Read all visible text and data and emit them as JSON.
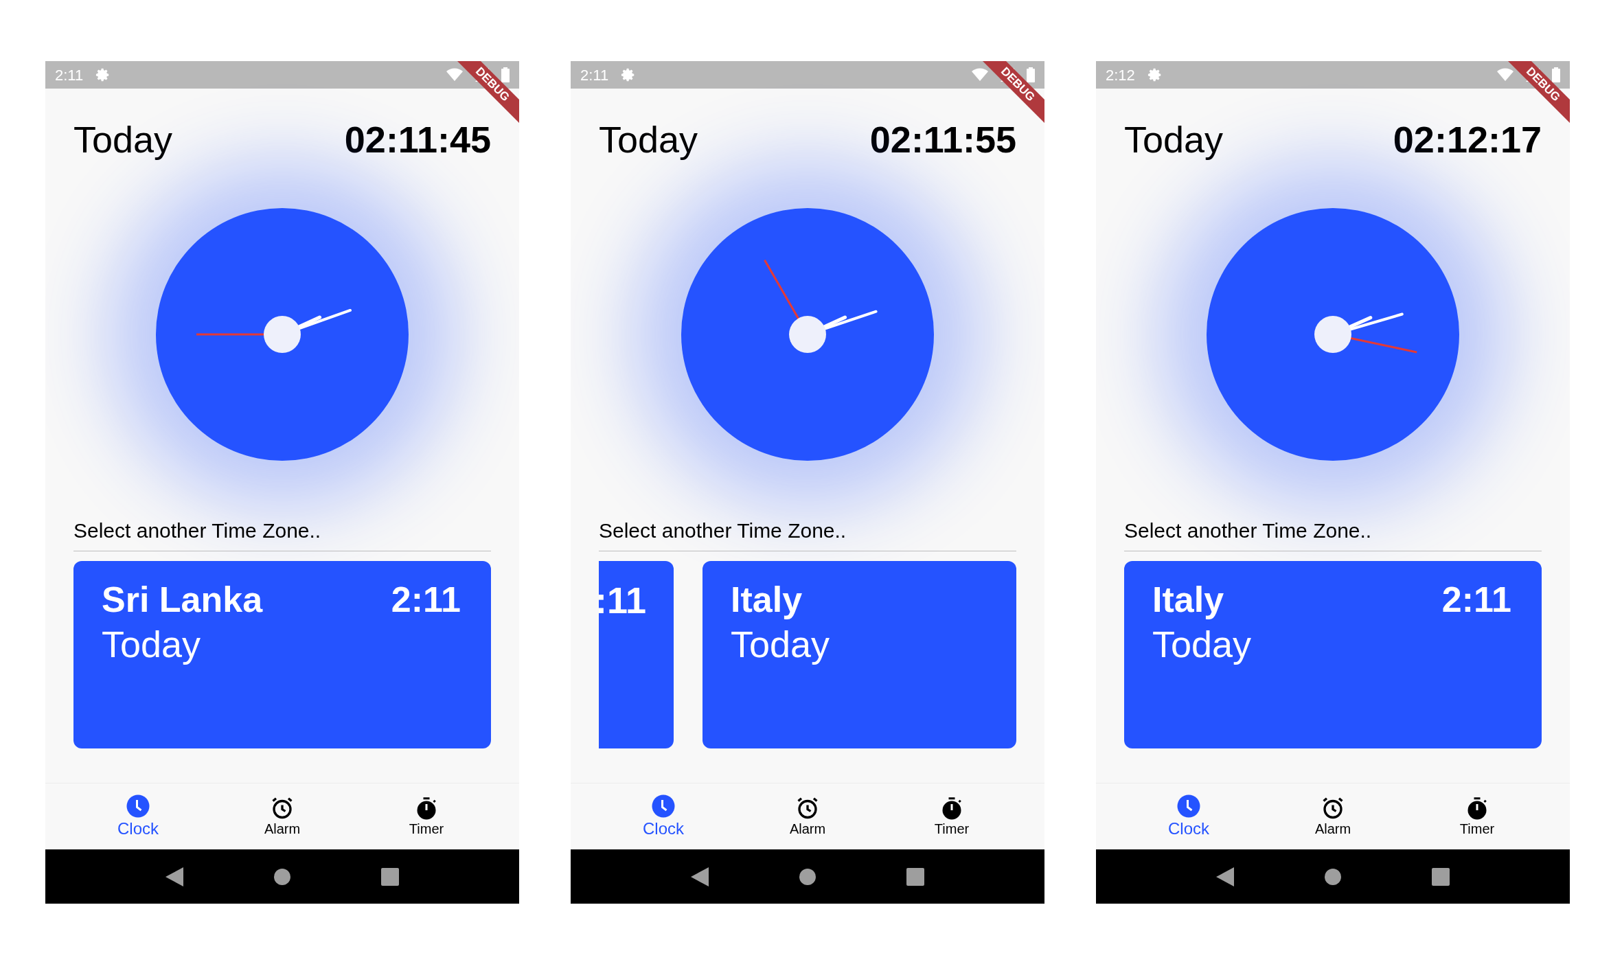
{
  "screens": [
    {
      "status_bar": {
        "time": "2:11"
      },
      "debug_banner": "DEBUG",
      "header": {
        "title": "Today",
        "time": "02:11:45"
      },
      "prompt": "Select another Time Zone..",
      "cards": [
        {
          "kind": "full",
          "name": "Sri Lanka",
          "time": "2:11",
          "day": "Today"
        }
      ],
      "nav": [
        {
          "label": "Clock",
          "selected": true
        },
        {
          "label": "Alarm",
          "selected": false
        },
        {
          "label": "Timer",
          "selected": false
        }
      ]
    },
    {
      "status_bar": {
        "time": "2:11"
      },
      "debug_banner": "DEBUG",
      "header": {
        "title": "Today",
        "time": "02:11:55"
      },
      "prompt": "Select another Time Zone..",
      "cards": [
        {
          "kind": "clipped",
          "time": ":11"
        },
        {
          "kind": "full",
          "name": "Italy",
          "day": "Today"
        }
      ],
      "nav": [
        {
          "label": "Clock",
          "selected": true
        },
        {
          "label": "Alarm",
          "selected": false
        },
        {
          "label": "Timer",
          "selected": false
        }
      ]
    },
    {
      "status_bar": {
        "time": "2:12"
      },
      "debug_banner": "DEBUG",
      "header": {
        "title": "Today",
        "time": "02:12:17"
      },
      "prompt": "Select another Time Zone..",
      "cards": [
        {
          "kind": "full",
          "name": "Italy",
          "time": "2:11",
          "day": "Today"
        }
      ],
      "nav": [
        {
          "label": "Clock",
          "selected": true
        },
        {
          "label": "Alarm",
          "selected": false
        },
        {
          "label": "Timer",
          "selected": false
        }
      ]
    }
  ]
}
